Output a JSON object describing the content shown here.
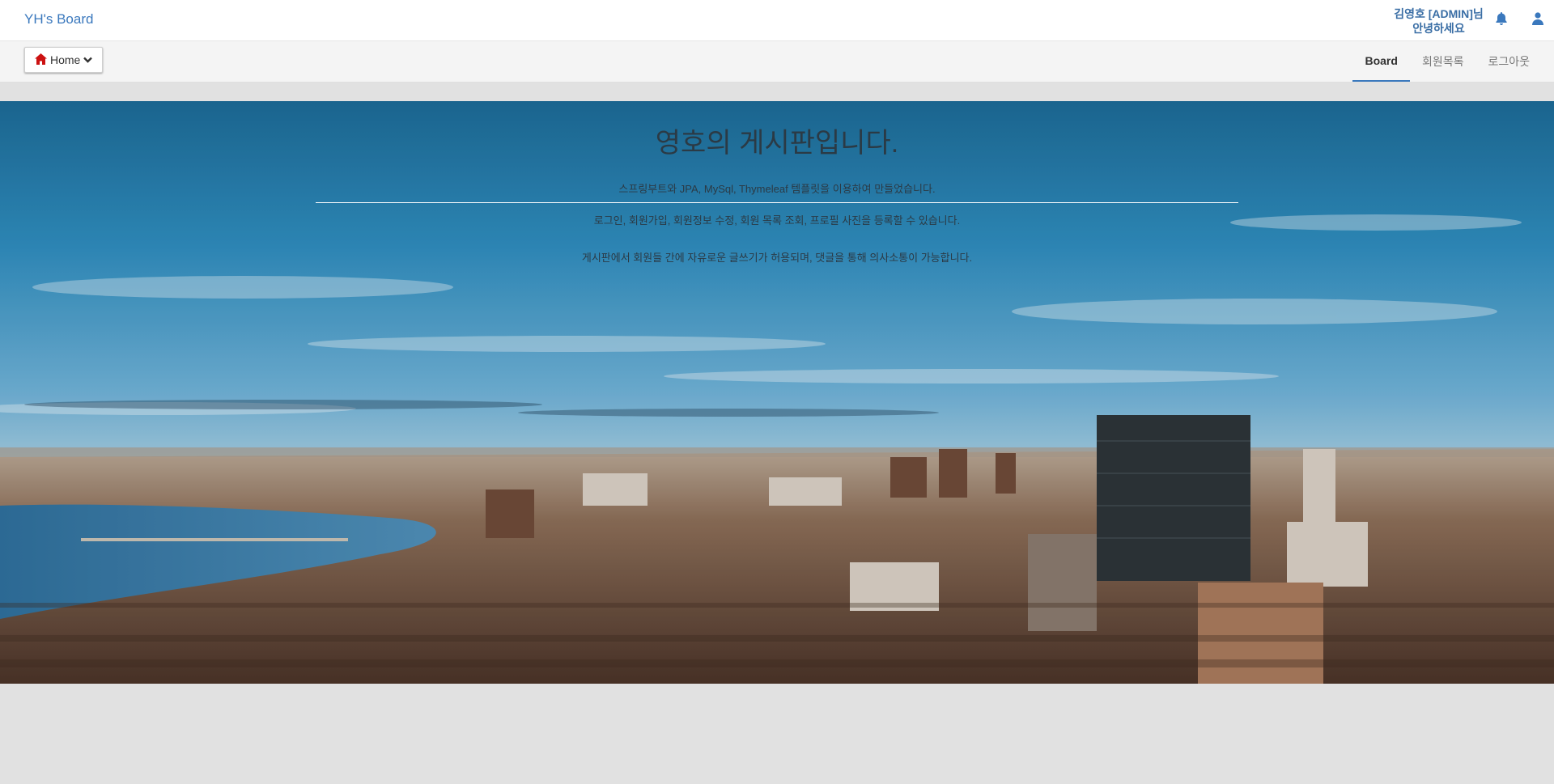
{
  "header": {
    "brand": "YH's Board",
    "user_line1": "김영호 [ADMIN]님",
    "user_line2": "안녕하세요",
    "icons": [
      "bell-icon",
      "user-icon"
    ]
  },
  "navbar": {
    "home_label": "Home",
    "links": [
      {
        "label": "Board",
        "active": true
      },
      {
        "label": "회원목록",
        "active": false
      },
      {
        "label": "로그아웃",
        "active": false
      }
    ]
  },
  "hero": {
    "title": "영호의 게시판입니다.",
    "line1": "스프링부트와 JPA, MySql, Thymeleaf 템플릿을 이용하여 만들었습니다.",
    "line2": "로그인, 회원가입, 회원정보 수정, 회원 목록 조회, 프로필 사진을 등록할 수 있습니다.",
    "line3": "게시판에서 회원들 간에 자유로운 글쓰기가 허용되며, 댓글을 통해 의사소통이 가능합니다."
  },
  "colors": {
    "brand": "#3a78bd",
    "active_tab_underline": "#3a78bd",
    "page_bg": "#e1e1e1",
    "home_icon": "#cc1111"
  }
}
